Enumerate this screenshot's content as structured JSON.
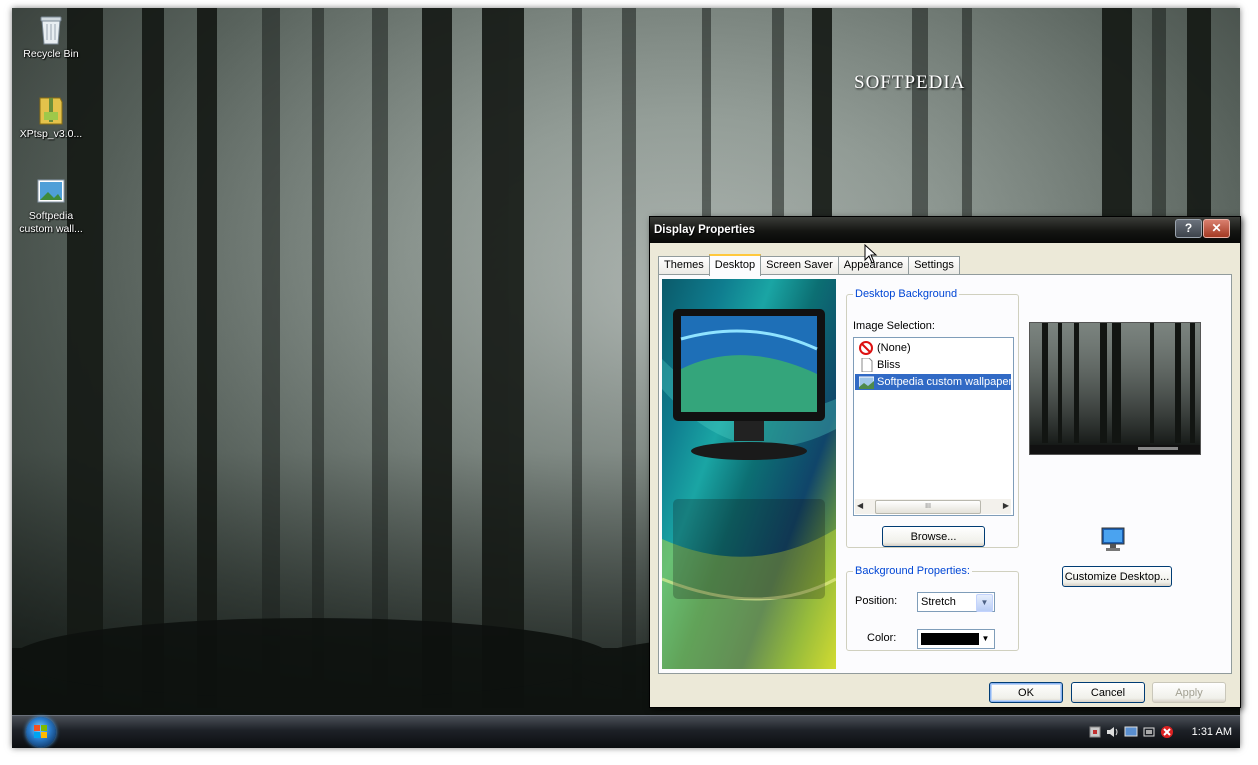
{
  "desktop": {
    "watermark": "SOFTPEDIA",
    "icons": [
      {
        "label": "Recycle Bin",
        "icon": "recycle-bin-icon"
      },
      {
        "label": "XPtsp_v3.0...",
        "icon": "archive-folder-icon"
      },
      {
        "label": "Softpedia custom wall...",
        "icon": "image-file-icon"
      }
    ]
  },
  "taskbar": {
    "start_icon": "windows-orb-icon",
    "tray_icons": [
      "network-icon",
      "volume-icon",
      "display-icon",
      "usb-icon",
      "security-alert-icon"
    ],
    "clock": "1:31 AM"
  },
  "dialog": {
    "title": "Display Properties",
    "help_glyph": "?",
    "close_glyph": "✕",
    "tabs": [
      "Themes",
      "Desktop",
      "Screen Saver",
      "Appearance",
      "Settings"
    ],
    "active_tab": "Desktop",
    "desktop_background": {
      "legend": "Desktop Background",
      "image_selection_label": "Image Selection:",
      "items": [
        {
          "label": "(None)",
          "icon": "none-icon"
        },
        {
          "label": "Bliss",
          "icon": "blank-file-icon"
        },
        {
          "label": "Softpedia custom wallpaper (",
          "icon": "image-thumb-icon",
          "selected": true
        }
      ],
      "scroll_thumb_glyph": "III",
      "browse_label": "Browse..."
    },
    "background_properties": {
      "legend": "Background Properties:",
      "position_label": "Position:",
      "position_value": "Stretch",
      "color_label": "Color:",
      "color_value": "#000000"
    },
    "customize_label": "Customize Desktop...",
    "buttons": {
      "ok": "OK",
      "cancel": "Cancel",
      "apply": "Apply"
    }
  }
}
